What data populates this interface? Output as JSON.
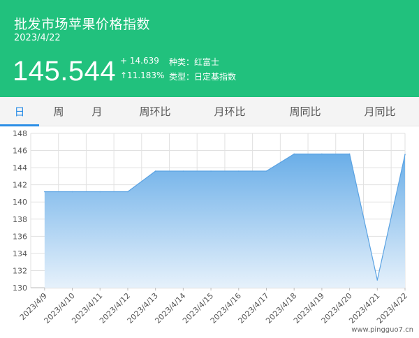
{
  "header": {
    "title": "批发市场苹果价格指数",
    "date": "2023/4/22",
    "price": "145.544",
    "change": "+ 14.639",
    "change_pct": "↑11.183%",
    "variety": "种类：红富士",
    "type": "类型：日定基指数",
    "bg_color": "#21c17d"
  },
  "tabs": [
    {
      "label": "日",
      "active": true
    },
    {
      "label": "周",
      "active": false
    },
    {
      "label": "月",
      "active": false
    },
    {
      "label": "周环比",
      "active": false
    },
    {
      "label": "月环比",
      "active": false
    },
    {
      "label": "周同比",
      "active": false
    },
    {
      "label": "月同比",
      "active": false
    }
  ],
  "watermark": "www.pingguo7.cn",
  "chart_data": {
    "type": "area",
    "categories": [
      "2023/4/9",
      "2023/4/10",
      "2023/4/11",
      "2023/4/12",
      "2023/4/13",
      "2023/4/14",
      "2023/4/15",
      "2023/4/16",
      "2023/4/17",
      "2023/4/18",
      "2023/4/19",
      "2023/4/20",
      "2023/4/21",
      "2023/4/22"
    ],
    "values": [
      141.2,
      141.2,
      141.2,
      141.2,
      143.6,
      143.6,
      143.6,
      143.6,
      143.6,
      145.6,
      145.6,
      145.6,
      130.9,
      145.544
    ],
    "ylim": [
      130,
      148
    ],
    "yticks": [
      130,
      132,
      134,
      136,
      138,
      140,
      142,
      144,
      146,
      148
    ],
    "grid": true,
    "fill_top_color": "#6aaee8",
    "fill_bottom_color": "#e6f1fb",
    "line_color": "#5aa2e2"
  }
}
